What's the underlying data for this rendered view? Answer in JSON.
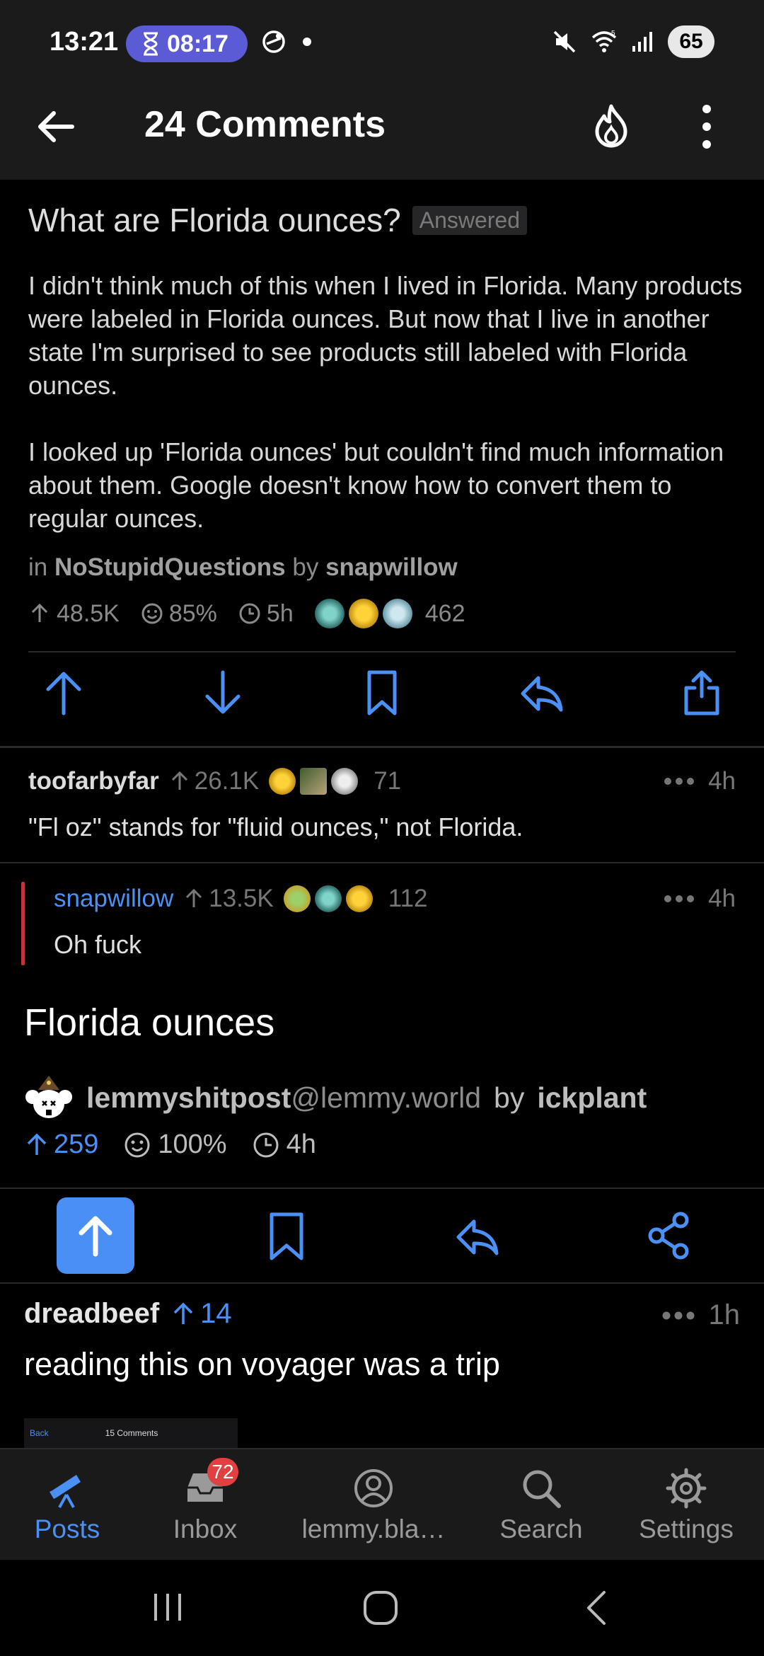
{
  "status_bar": {
    "time": "13:21",
    "timer": "08:17",
    "battery": "65"
  },
  "header": {
    "title": "24 Comments"
  },
  "post": {
    "title": "What are Florida ounces?",
    "flair": "Answered",
    "body_p1": "I didn't think much of this when I lived in Florida. Many products were labeled in Florida ounces. But now that I live in another state I'm surprised to see products still labeled with Florida ounces.",
    "body_p2": "I looked up 'Florida ounces' but couldn't find much information about them. Google doesn't know how to convert them to regular ounces.",
    "in_label": "in",
    "subreddit": "NoStupidQuestions",
    "by_label": "by",
    "author": "snapwillow",
    "score": "48.5K",
    "ratio": "85%",
    "age": "5h",
    "award_count": "462"
  },
  "comments": [
    {
      "user": "toofarbyfar",
      "score": "26.1K",
      "award_count": "71",
      "age": "4h",
      "text": "\"Fl oz\" stands for \"fluid ounces,\" not Florida."
    },
    {
      "user": "snapwillow",
      "score": "13.5K",
      "award_count": "112",
      "age": "4h",
      "text": "Oh fuck"
    }
  ],
  "shared_post": {
    "title": "Florida ounces",
    "community": "lemmyshitpost",
    "instance": "@lemmy.world",
    "by_label": "by",
    "author": "ickplant",
    "score": "259",
    "ratio": "100%",
    "age": "4h"
  },
  "reply": {
    "user": "dreadbeef",
    "score": "14",
    "age": "1h",
    "text": "reading this on voyager was a trip",
    "thumb_back": "Back",
    "thumb_title": "15 Comments"
  },
  "tabs": [
    {
      "label": "Posts",
      "icon": "telescope-icon"
    },
    {
      "label": "Inbox",
      "icon": "inbox-icon",
      "badge": "72"
    },
    {
      "label": "lemmy.bla…",
      "icon": "account-icon"
    },
    {
      "label": "Search",
      "icon": "search-icon"
    },
    {
      "label": "Settings",
      "icon": "gear-icon"
    }
  ],
  "colors": {
    "accent": "#4a90f5",
    "badge_red": "#e04040",
    "thread_bar": "#c0353c",
    "timer_pill": "#5b5bd6"
  }
}
